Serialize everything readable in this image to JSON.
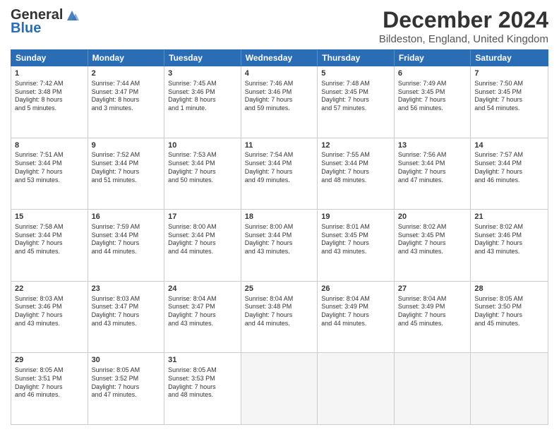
{
  "header": {
    "logo_general": "General",
    "logo_blue": "Blue",
    "title": "December 2024",
    "subtitle": "Bildeston, England, United Kingdom"
  },
  "calendar": {
    "days": [
      "Sunday",
      "Monday",
      "Tuesday",
      "Wednesday",
      "Thursday",
      "Friday",
      "Saturday"
    ],
    "weeks": [
      [
        {
          "num": "1",
          "lines": [
            "Sunrise: 7:42 AM",
            "Sunset: 3:48 PM",
            "Daylight: 8 hours",
            "and 5 minutes."
          ]
        },
        {
          "num": "2",
          "lines": [
            "Sunrise: 7:44 AM",
            "Sunset: 3:47 PM",
            "Daylight: 8 hours",
            "and 3 minutes."
          ]
        },
        {
          "num": "3",
          "lines": [
            "Sunrise: 7:45 AM",
            "Sunset: 3:46 PM",
            "Daylight: 8 hours",
            "and 1 minute."
          ]
        },
        {
          "num": "4",
          "lines": [
            "Sunrise: 7:46 AM",
            "Sunset: 3:46 PM",
            "Daylight: 7 hours",
            "and 59 minutes."
          ]
        },
        {
          "num": "5",
          "lines": [
            "Sunrise: 7:48 AM",
            "Sunset: 3:45 PM",
            "Daylight: 7 hours",
            "and 57 minutes."
          ]
        },
        {
          "num": "6",
          "lines": [
            "Sunrise: 7:49 AM",
            "Sunset: 3:45 PM",
            "Daylight: 7 hours",
            "and 56 minutes."
          ]
        },
        {
          "num": "7",
          "lines": [
            "Sunrise: 7:50 AM",
            "Sunset: 3:45 PM",
            "Daylight: 7 hours",
            "and 54 minutes."
          ]
        }
      ],
      [
        {
          "num": "8",
          "lines": [
            "Sunrise: 7:51 AM",
            "Sunset: 3:44 PM",
            "Daylight: 7 hours",
            "and 53 minutes."
          ]
        },
        {
          "num": "9",
          "lines": [
            "Sunrise: 7:52 AM",
            "Sunset: 3:44 PM",
            "Daylight: 7 hours",
            "and 51 minutes."
          ]
        },
        {
          "num": "10",
          "lines": [
            "Sunrise: 7:53 AM",
            "Sunset: 3:44 PM",
            "Daylight: 7 hours",
            "and 50 minutes."
          ]
        },
        {
          "num": "11",
          "lines": [
            "Sunrise: 7:54 AM",
            "Sunset: 3:44 PM",
            "Daylight: 7 hours",
            "and 49 minutes."
          ]
        },
        {
          "num": "12",
          "lines": [
            "Sunrise: 7:55 AM",
            "Sunset: 3:44 PM",
            "Daylight: 7 hours",
            "and 48 minutes."
          ]
        },
        {
          "num": "13",
          "lines": [
            "Sunrise: 7:56 AM",
            "Sunset: 3:44 PM",
            "Daylight: 7 hours",
            "and 47 minutes."
          ]
        },
        {
          "num": "14",
          "lines": [
            "Sunrise: 7:57 AM",
            "Sunset: 3:44 PM",
            "Daylight: 7 hours",
            "and 46 minutes."
          ]
        }
      ],
      [
        {
          "num": "15",
          "lines": [
            "Sunrise: 7:58 AM",
            "Sunset: 3:44 PM",
            "Daylight: 7 hours",
            "and 45 minutes."
          ]
        },
        {
          "num": "16",
          "lines": [
            "Sunrise: 7:59 AM",
            "Sunset: 3:44 PM",
            "Daylight: 7 hours",
            "and 44 minutes."
          ]
        },
        {
          "num": "17",
          "lines": [
            "Sunrise: 8:00 AM",
            "Sunset: 3:44 PM",
            "Daylight: 7 hours",
            "and 44 minutes."
          ]
        },
        {
          "num": "18",
          "lines": [
            "Sunrise: 8:00 AM",
            "Sunset: 3:44 PM",
            "Daylight: 7 hours",
            "and 43 minutes."
          ]
        },
        {
          "num": "19",
          "lines": [
            "Sunrise: 8:01 AM",
            "Sunset: 3:45 PM",
            "Daylight: 7 hours",
            "and 43 minutes."
          ]
        },
        {
          "num": "20",
          "lines": [
            "Sunrise: 8:02 AM",
            "Sunset: 3:45 PM",
            "Daylight: 7 hours",
            "and 43 minutes."
          ]
        },
        {
          "num": "21",
          "lines": [
            "Sunrise: 8:02 AM",
            "Sunset: 3:46 PM",
            "Daylight: 7 hours",
            "and 43 minutes."
          ]
        }
      ],
      [
        {
          "num": "22",
          "lines": [
            "Sunrise: 8:03 AM",
            "Sunset: 3:46 PM",
            "Daylight: 7 hours",
            "and 43 minutes."
          ]
        },
        {
          "num": "23",
          "lines": [
            "Sunrise: 8:03 AM",
            "Sunset: 3:47 PM",
            "Daylight: 7 hours",
            "and 43 minutes."
          ]
        },
        {
          "num": "24",
          "lines": [
            "Sunrise: 8:04 AM",
            "Sunset: 3:47 PM",
            "Daylight: 7 hours",
            "and 43 minutes."
          ]
        },
        {
          "num": "25",
          "lines": [
            "Sunrise: 8:04 AM",
            "Sunset: 3:48 PM",
            "Daylight: 7 hours",
            "and 44 minutes."
          ]
        },
        {
          "num": "26",
          "lines": [
            "Sunrise: 8:04 AM",
            "Sunset: 3:49 PM",
            "Daylight: 7 hours",
            "and 44 minutes."
          ]
        },
        {
          "num": "27",
          "lines": [
            "Sunrise: 8:04 AM",
            "Sunset: 3:49 PM",
            "Daylight: 7 hours",
            "and 45 minutes."
          ]
        },
        {
          "num": "28",
          "lines": [
            "Sunrise: 8:05 AM",
            "Sunset: 3:50 PM",
            "Daylight: 7 hours",
            "and 45 minutes."
          ]
        }
      ],
      [
        {
          "num": "29",
          "lines": [
            "Sunrise: 8:05 AM",
            "Sunset: 3:51 PM",
            "Daylight: 7 hours",
            "and 46 minutes."
          ]
        },
        {
          "num": "30",
          "lines": [
            "Sunrise: 8:05 AM",
            "Sunset: 3:52 PM",
            "Daylight: 7 hours",
            "and 47 minutes."
          ]
        },
        {
          "num": "31",
          "lines": [
            "Sunrise: 8:05 AM",
            "Sunset: 3:53 PM",
            "Daylight: 7 hours",
            "and 48 minutes."
          ]
        },
        {
          "num": "",
          "lines": []
        },
        {
          "num": "",
          "lines": []
        },
        {
          "num": "",
          "lines": []
        },
        {
          "num": "",
          "lines": []
        }
      ]
    ]
  }
}
